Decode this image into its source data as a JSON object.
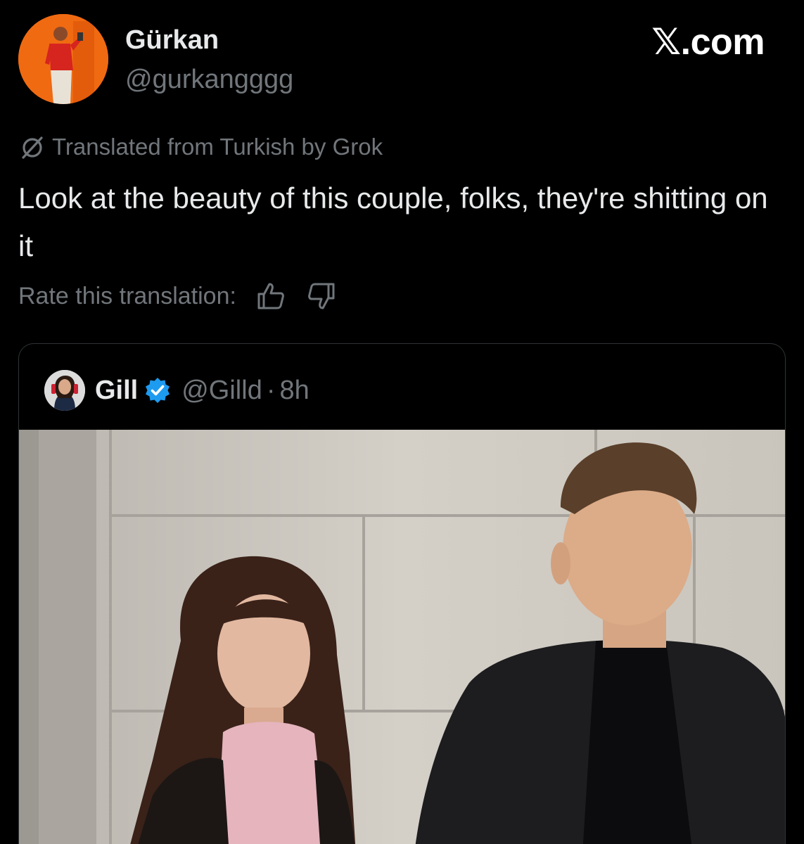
{
  "author": {
    "display_name": "Gürkan",
    "handle": "@gurkangggg",
    "avatar_icon": "profile-photo"
  },
  "brand": {
    "label": "𝕏.com"
  },
  "translation": {
    "label": "Translated from Turkish by Grok",
    "icon": "grok-icon",
    "text": "Look at the beauty of this couple, folks, they're shitting on it",
    "rate_label": "Rate this translation:",
    "rate_up_icon": "thumbs-up-icon",
    "rate_down_icon": "thumbs-down-icon"
  },
  "quote": {
    "name": "Gill",
    "verified_icon": "verified-badge-icon",
    "handle": "@Gilld",
    "separator": "·",
    "time": "8h",
    "media": "photo of a young couple walking in front of a concrete wall"
  },
  "colors": {
    "background": "#000000",
    "text_primary": "#e7e9ea",
    "text_secondary": "#71767b",
    "verified": "#1d9bf0",
    "border": "#2f3336"
  }
}
